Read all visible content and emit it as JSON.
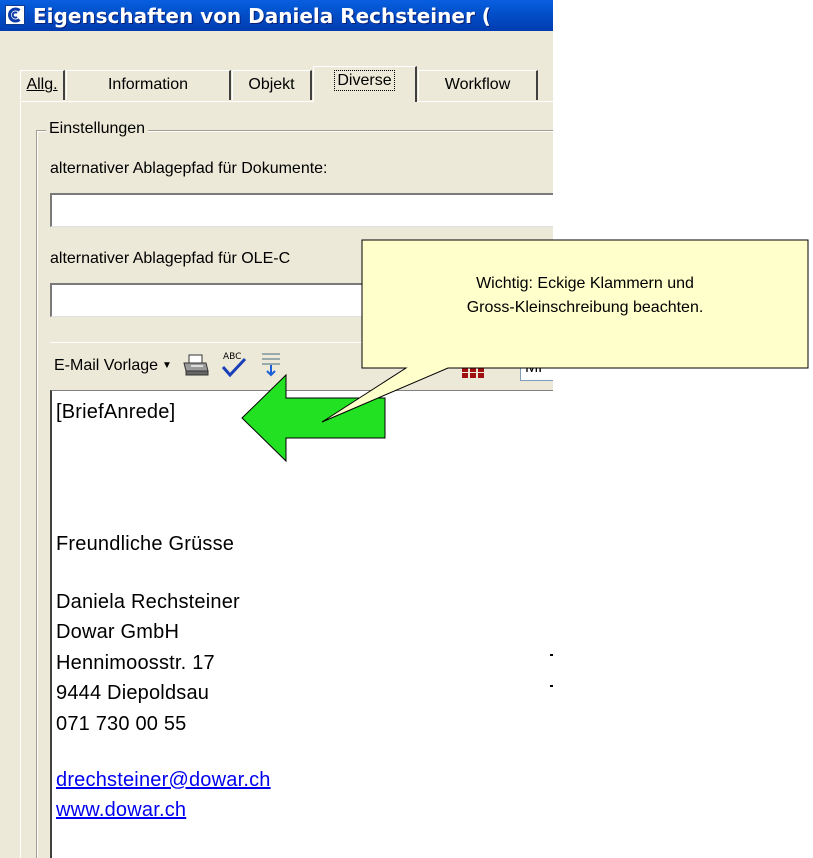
{
  "window": {
    "title": "Eigenschaften von Daniela Rechsteiner (",
    "app_icon": "app-logo-icon",
    "titlebar_color": "#0458d6"
  },
  "tabs": [
    {
      "label": "Allg.",
      "active": false
    },
    {
      "label": "Information",
      "active": false
    },
    {
      "label": "Objekt",
      "active": false
    },
    {
      "label": "Diverse",
      "active": true
    },
    {
      "label": "Workflow",
      "active": false
    }
  ],
  "settings": {
    "group_title": "Einstellungen",
    "doc_path_label": "alternativer Ablagepfad für Dokumente:",
    "doc_path_value": "",
    "ole_path_label": "alternativer Ablagepfad für OLE-C",
    "ole_path_value": ""
  },
  "toolbar": {
    "template_button": "E-Mail Vorlage",
    "icons": [
      "printer-icon",
      "spellcheck-icon",
      "insert-icon",
      "table-icon"
    ],
    "font_combo_value": "Mi"
  },
  "editor": {
    "lines": [
      "[BriefAnrede]",
      "Freundliche Grüsse",
      "Daniela Rechsteiner",
      "Dowar GmbH",
      "Hennimoosstr. 17",
      "9444 Diepoldsau",
      "071 730 00 55"
    ],
    "email": "drechsteiner@dowar.ch",
    "website": "www.dowar.ch"
  },
  "annotation": {
    "line1": "Wichtig: Eckige Klammern und",
    "line2": "Gross-Kleinschreibung beachten.",
    "bubble_color": "#ffffcc",
    "arrow_color": "#22e022"
  }
}
